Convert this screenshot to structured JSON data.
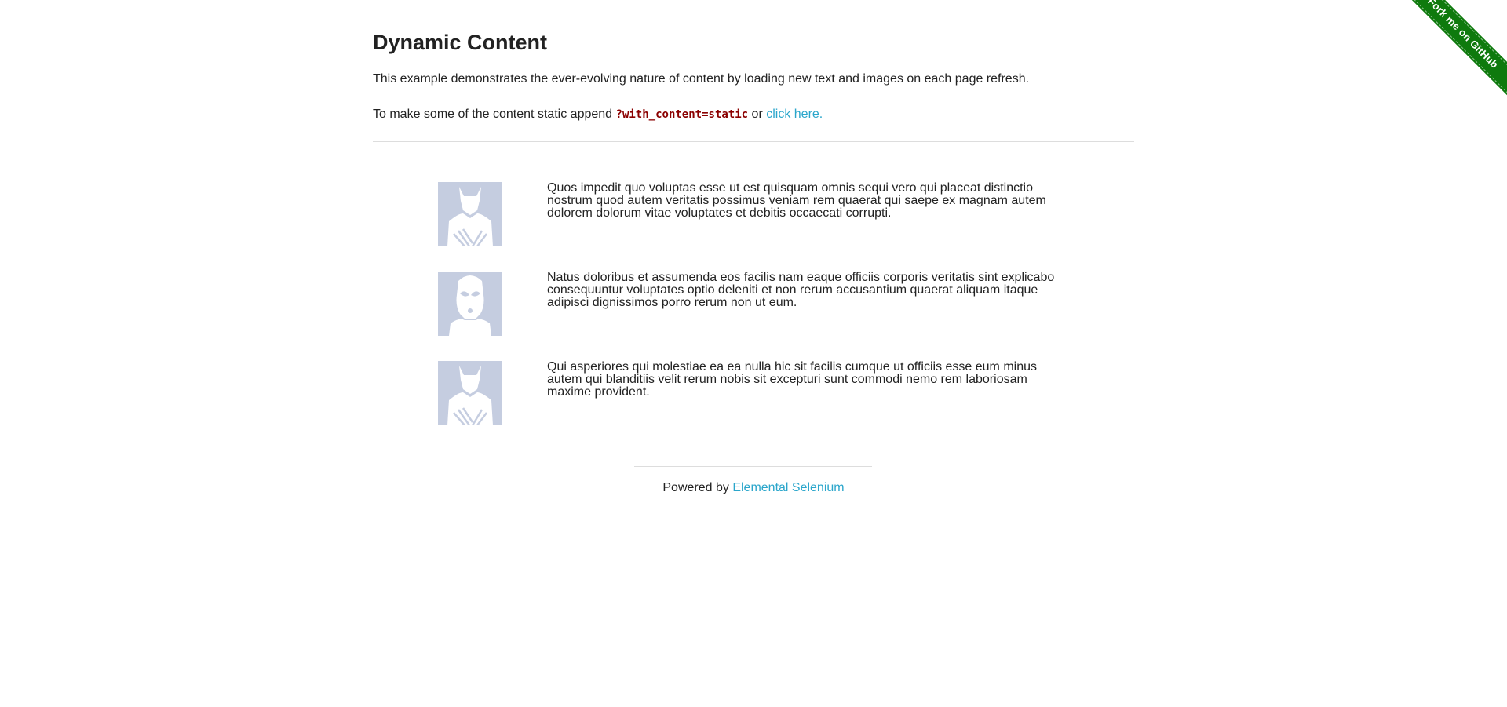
{
  "ribbon": {
    "label": "Fork me on GitHub",
    "color": "#0e7a0d"
  },
  "page": {
    "title": "Dynamic Content",
    "description": "This example demonstrates the ever-evolving nature of content by loading new text and images on each page refresh.",
    "static_prefix": "To make some of the content static append ",
    "static_param": "?with_content=static",
    "static_or": " or ",
    "static_link": "click here."
  },
  "rows": [
    {
      "avatar_icon": "wolverine-avatar-icon",
      "text": "Quos impedit quo voluptas esse ut est quisquam omnis sequi vero qui placeat distinctio nostrum quod autem veritatis possimus veniam rem quaerat qui saepe ex magnam autem dolorem dolorum vitae voluptates et debitis occaecati corrupti."
    },
    {
      "avatar_icon": "stormtrooper-avatar-icon",
      "text": "Natus doloribus et assumenda eos facilis nam eaque officiis corporis veritatis sint explicabo consequuntur voluptates optio deleniti et non rerum accusantium quaerat aliquam itaque adipisci dignissimos porro rerum non ut eum."
    },
    {
      "avatar_icon": "wolverine-avatar-icon",
      "text": "Qui asperiores qui molestiae ea ea nulla hic sit facilis cumque ut officiis esse eum minus autem qui blanditiis velit rerum nobis sit excepturi sunt commodi nemo rem laboriosam maxime provident."
    }
  ],
  "footer": {
    "prefix": "Powered by ",
    "link": "Elemental Selenium"
  },
  "colors": {
    "link": "#2ba6cb",
    "code": "#8b0000",
    "avatar_bg": "#c5cde0"
  }
}
